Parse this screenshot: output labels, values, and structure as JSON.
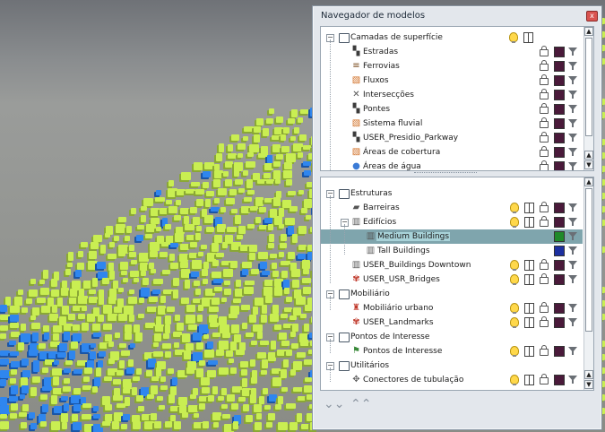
{
  "panel": {
    "title": "Navegador de modelos",
    "close": "x"
  },
  "surface_layers": {
    "group_label": "Camadas de superfície",
    "items": [
      {
        "label": "Estradas",
        "icon": "road-icon"
      },
      {
        "label": "Ferrovias",
        "icon": "railway-icon"
      },
      {
        "label": "Fluxos",
        "icon": "flow-icon"
      },
      {
        "label": "Intersecções",
        "icon": "intersection-icon"
      },
      {
        "label": "Pontes",
        "icon": "bridge-icon"
      },
      {
        "label": "Sistema fluvial",
        "icon": "river-icon"
      },
      {
        "label": "USER_Presidio_Parkway",
        "icon": "road-icon"
      },
      {
        "label": "Áreas de cobertura",
        "icon": "coverage-icon"
      },
      {
        "label": "Áreas de água",
        "icon": "water-drop-icon"
      }
    ]
  },
  "structures": {
    "groups": [
      {
        "label": "Estruturas"
      },
      {
        "label": "Mobiliário"
      },
      {
        "label": "Pontos de Interesse"
      },
      {
        "label": "Utilitários"
      }
    ],
    "items": [
      {
        "label": "Barreiras"
      },
      {
        "label": "Edifícios"
      },
      {
        "label": "Medium Buildings"
      },
      {
        "label": "Tall Buildings"
      },
      {
        "label": "USER_Buildings Downtown"
      },
      {
        "label": "USER_USR_Bridges"
      },
      {
        "label": "Mobiliário urbano"
      },
      {
        "label": "USER_Landmarks"
      },
      {
        "label": "Pontos de Interesse"
      },
      {
        "label": "Conectores de tubulação"
      }
    ]
  },
  "colors": {
    "magenta_style": "#4a1a3a",
    "medium_buildings": "#1f8a2a",
    "tall_buildings": "#1c2fa0",
    "selection": "#7fa5ad",
    "building_green": "#c9ee52",
    "building_blue": "#2f86ee"
  },
  "glyphs": {
    "expand_minus": "−",
    "scroll_up": "▲",
    "scroll_down": "▼",
    "collapse_all": "⌄⌄",
    "expand_all": "⌃⌃"
  }
}
